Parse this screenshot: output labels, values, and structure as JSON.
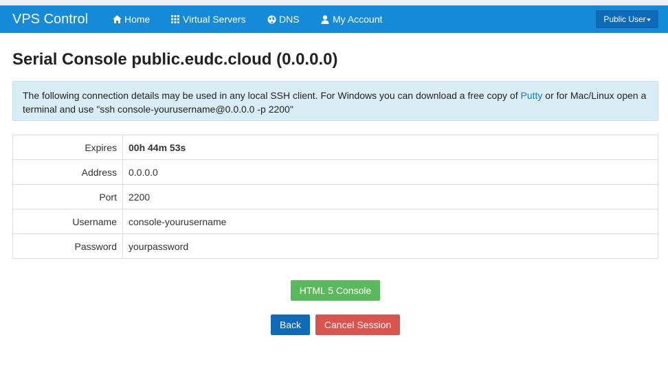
{
  "nav": {
    "brand": "VPS Control",
    "items": [
      {
        "label": "Home",
        "icon": "home-icon"
      },
      {
        "label": "Virtual Servers",
        "icon": "grid-icon"
      },
      {
        "label": "DNS",
        "icon": "globe-icon"
      },
      {
        "label": "My Account",
        "icon": "user-icon"
      }
    ],
    "user_menu": "Public User"
  },
  "page": {
    "title": "Serial Console public.eudc.cloud (0.0.0.0)",
    "info": {
      "text_before": "The following connection details may be used in any local SSH client. For Windows you can download a free copy of ",
      "link": "Putty",
      "text_after": " or for Mac/Linux open a terminal and use \"ssh console-yourusername@0.0.0.0 -p 2200\""
    }
  },
  "details": {
    "rows": [
      {
        "label": "Expires",
        "value": "00h 44m 53s"
      },
      {
        "label": "Address",
        "value": "0.0.0.0"
      },
      {
        "label": "Port",
        "value": "2200"
      },
      {
        "label": "Username",
        "value": "console-yourusername"
      },
      {
        "label": "Password",
        "value": "yourpassword"
      }
    ]
  },
  "actions": {
    "console": "HTML 5 Console",
    "back": "Back",
    "cancel": "Cancel Session"
  },
  "colors": {
    "navbar": "#148ad8",
    "user_button": "#0f6bb8",
    "info_background": "#d9edf7",
    "console_button": "#5cb85c",
    "back_button": "#0f6bb8",
    "cancel_button": "#d9534f",
    "link": "#1a78c2"
  }
}
